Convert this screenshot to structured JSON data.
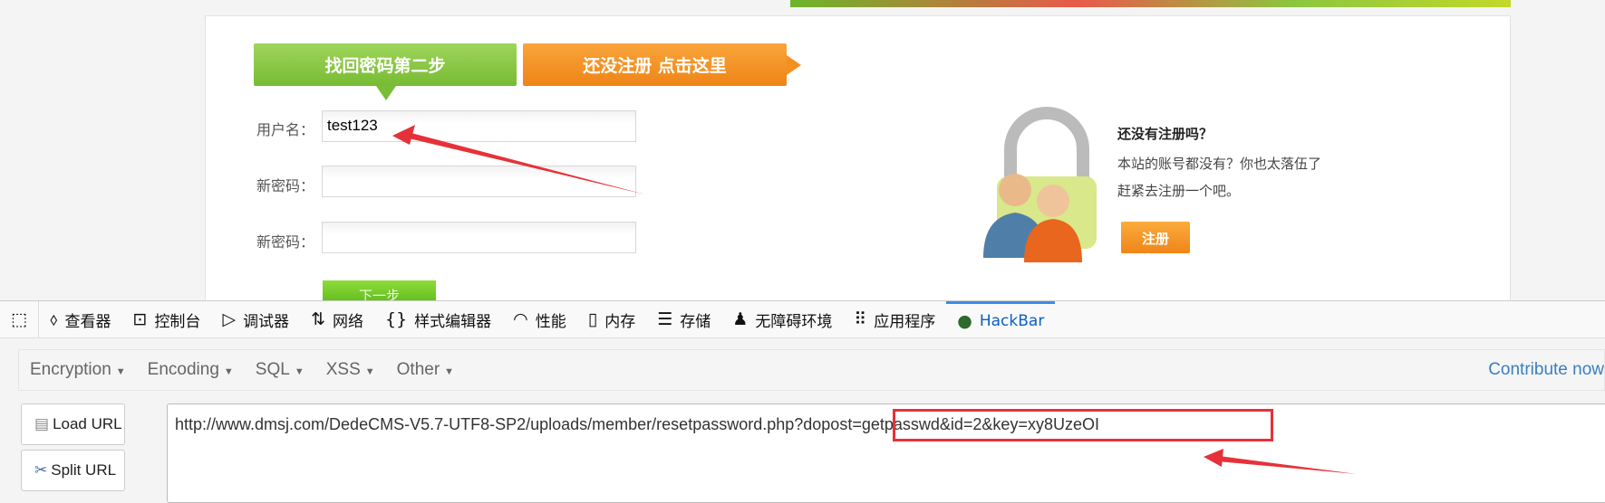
{
  "page": {
    "step_tab": "找回密码第二步",
    "register_tab": "还没注册 点击这里",
    "fields": [
      {
        "label": "用户名：",
        "value": "test123"
      },
      {
        "label": "新密码：",
        "value": ""
      },
      {
        "label": "新密码：",
        "value": ""
      }
    ],
    "next_button": "下一步",
    "side": {
      "title": "还没有注册吗？",
      "line1": "本站的账号都没有？你也太落伍了",
      "line2": "赶紧去注册一个吧。",
      "button": "注册"
    }
  },
  "devtools": {
    "tabs": [
      {
        "label": "查看器",
        "icon": "inspector-icon"
      },
      {
        "label": "控制台",
        "icon": "console-icon"
      },
      {
        "label": "调试器",
        "icon": "debugger-icon"
      },
      {
        "label": "网络",
        "icon": "network-icon"
      },
      {
        "label": "样式编辑器",
        "icon": "style-editor-icon"
      },
      {
        "label": "性能",
        "icon": "performance-icon"
      },
      {
        "label": "内存",
        "icon": "memory-icon"
      },
      {
        "label": "存储",
        "icon": "storage-icon"
      },
      {
        "label": "无障碍环境",
        "icon": "accessibility-icon"
      },
      {
        "label": "应用程序",
        "icon": "application-icon"
      },
      {
        "label": "HackBar",
        "icon": "hackbar-icon",
        "active": true
      }
    ]
  },
  "hackbar": {
    "menu": [
      "Encryption",
      "Encoding",
      "SQL",
      "XSS",
      "Other"
    ],
    "contribute": "Contribute now",
    "load_url": "Load URL",
    "split_url": "Split URL",
    "url_base": "http://www.dmsj.com/DedeCMS-V5.7-UTF8-SP2/uploads/member/resetpassword.php",
    "url_query": "?dopost=getpasswd&id=2&key=xy8UzeOI"
  },
  "colors": {
    "accent_green": "#78bb34",
    "accent_orange": "#ee8516",
    "annotation_red": "#e53238",
    "hackbar_blue": "#0a5fc7"
  }
}
